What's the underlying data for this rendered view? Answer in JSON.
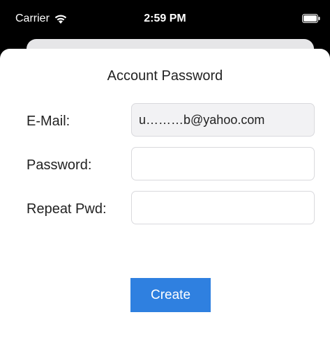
{
  "status_bar": {
    "carrier": "Carrier",
    "time": "2:59 PM",
    "icons": [
      "wifi-icon",
      "battery-icon"
    ]
  },
  "form": {
    "title": "Account Password",
    "email_label": "E-Mail:",
    "email_value": "u………b@yahoo.com",
    "password_label": "Password:",
    "password_value": "",
    "repeat_label": "Repeat Pwd:",
    "repeat_value": ""
  },
  "create_button": {
    "label": "Create"
  },
  "colors": {
    "accent": "#2f80e0",
    "background": "#000000",
    "sheet": "#ffffff",
    "back_card": "#e6e6e8"
  }
}
